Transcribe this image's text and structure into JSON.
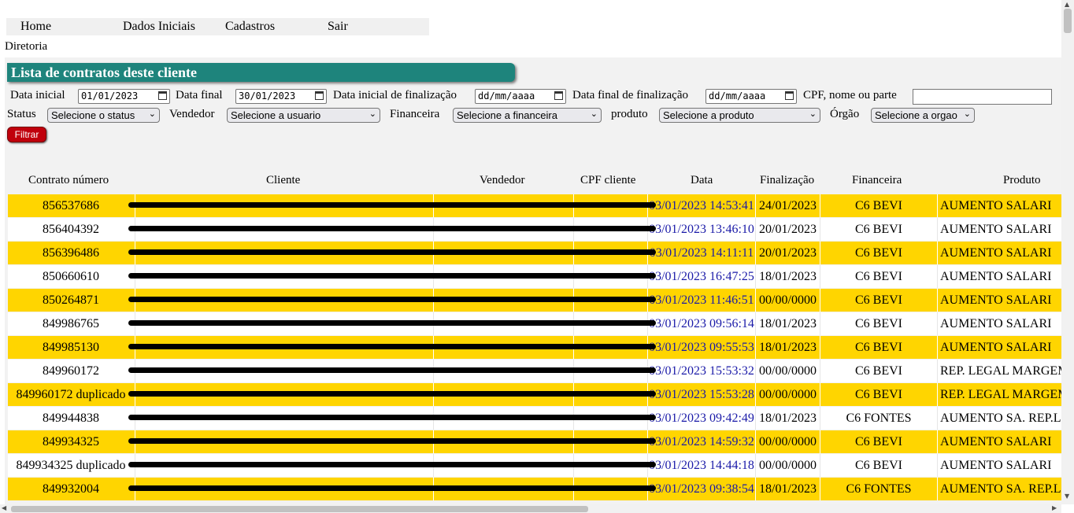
{
  "nav": {
    "items": [
      {
        "label": "Home"
      },
      {
        "label": "Dados Iniciais"
      },
      {
        "label": "Cadastros"
      },
      {
        "label": "Sair"
      }
    ]
  },
  "breadcrumb": "Diretoria",
  "panel_title": "Lista de contratos deste cliente",
  "filters": {
    "data_inicial_label": "Data inicial",
    "data_inicial_value": "01/01/2023",
    "data_final_label": "Data final",
    "data_final_value": "30/01/2023",
    "data_inicial_finalizacao_label": "Data inicial de finalização",
    "data_inicial_finalizacao_value": "dd/mm/aaaa",
    "data_final_finalizacao_label": "Data final de finalização",
    "data_final_finalizacao_value": "dd/mm/aaaa",
    "cpf_label": "CPF, nome ou parte",
    "status_label": "Status",
    "status_value": "Selecione o status",
    "vendedor_label": "Vendedor",
    "vendedor_value": "Selecione a usuario",
    "financeira_label": "Financeira",
    "financeira_value": "Selecione a financeira",
    "produto_label": "produto",
    "produto_value": "Selecione a produto",
    "orgao_label": "Órgão",
    "orgao_value": "Selecione a orgao",
    "filtrar_label": "Filtrar"
  },
  "table": {
    "headers": [
      "Contrato número",
      "Cliente",
      "Vendedor",
      "CPF cliente",
      "Data",
      "Finalização",
      "Financeira",
      "Produto"
    ],
    "rows": [
      {
        "contrato": "856537686",
        "data": "03/01/2023 14:53:41",
        "finalizacao": "24/01/2023",
        "financeira": "C6 BEVI",
        "produto": "AUMENTO SALARI"
      },
      {
        "contrato": "856404392",
        "data": "03/01/2023 13:46:10",
        "finalizacao": "20/01/2023",
        "financeira": "C6 BEVI",
        "produto": "AUMENTO SALARI"
      },
      {
        "contrato": "856396486",
        "data": "03/01/2023 14:11:11",
        "finalizacao": "20/01/2023",
        "financeira": "C6 BEVI",
        "produto": "AUMENTO SALARI"
      },
      {
        "contrato": "850660610",
        "data": "03/01/2023 16:47:25",
        "finalizacao": "18/01/2023",
        "financeira": "C6 BEVI",
        "produto": "AUMENTO SALARI"
      },
      {
        "contrato": "850264871",
        "data": "03/01/2023 11:46:51",
        "finalizacao": "00/00/0000",
        "financeira": "C6 BEVI",
        "produto": "AUMENTO SALARI"
      },
      {
        "contrato": "849986765",
        "data": "03/01/2023 09:56:14",
        "finalizacao": "18/01/2023",
        "financeira": "C6 BEVI",
        "produto": "AUMENTO SALARI"
      },
      {
        "contrato": "849985130",
        "data": "03/01/2023 09:55:53",
        "finalizacao": "18/01/2023",
        "financeira": "C6 BEVI",
        "produto": "AUMENTO SALARI"
      },
      {
        "contrato": "849960172",
        "data": "03/01/2023 15:53:32",
        "finalizacao": "00/00/0000",
        "financeira": "C6 BEVI",
        "produto": "REP. LEGAL MARGEM"
      },
      {
        "contrato": "849960172 duplicado",
        "data": "03/01/2023 15:53:28",
        "finalizacao": "00/00/0000",
        "financeira": "C6 BEVI",
        "produto": "REP. LEGAL MARGEM"
      },
      {
        "contrato": "849944838",
        "data": "03/01/2023 09:42:49",
        "finalizacao": "18/01/2023",
        "financeira": "C6 FONTES",
        "produto": "AUMENTO SA. REP.L"
      },
      {
        "contrato": "849934325",
        "data": "03/01/2023 14:59:32",
        "finalizacao": "00/00/0000",
        "financeira": "C6 BEVI",
        "produto": "AUMENTO SALARI"
      },
      {
        "contrato": "849934325 duplicado",
        "data": "03/01/2023 14:44:18",
        "finalizacao": "00/00/0000",
        "financeira": "C6 BEVI",
        "produto": "AUMENTO SALARI"
      },
      {
        "contrato": "849932004",
        "data": "03/01/2023 09:38:54",
        "finalizacao": "18/01/2023",
        "financeira": "C6 FONTES",
        "produto": "AUMENTO SA. REP.L"
      }
    ]
  },
  "colors": {
    "title_bar": "#1e847c",
    "row_highlight": "#ffd500",
    "date_link": "#1a1aa8",
    "filter_button": "#c0000c"
  }
}
